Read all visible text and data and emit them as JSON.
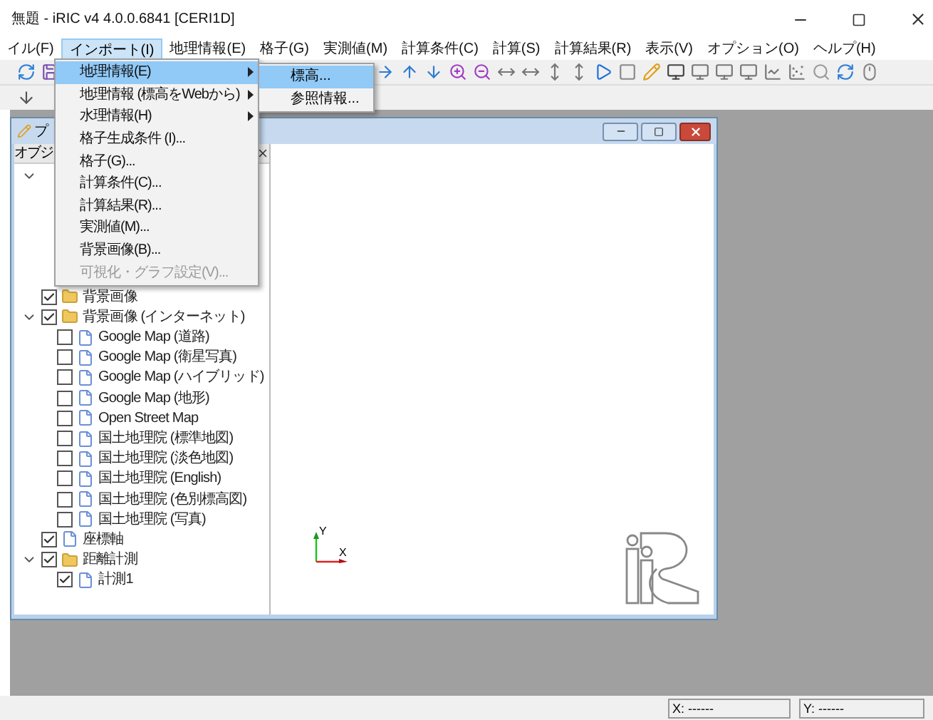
{
  "window": {
    "title": "無題 - iRIC v4 4.0.0.6841 [CERI1D]"
  },
  "menu_bar": [
    {
      "label": "イル(F)",
      "selected": false
    },
    {
      "label": "インポート(I)",
      "selected": true
    },
    {
      "label": "地理情報(E)",
      "selected": false
    },
    {
      "label": "格子(G)",
      "selected": false
    },
    {
      "label": "実測値(M)",
      "selected": false
    },
    {
      "label": "計算条件(C)",
      "selected": false
    },
    {
      "label": "計算(S)",
      "selected": false
    },
    {
      "label": "計算結果(R)",
      "selected": false
    },
    {
      "label": "表示(V)",
      "selected": false
    },
    {
      "label": "オプション(O)",
      "selected": false
    },
    {
      "label": "ヘルプ(H)",
      "selected": false
    }
  ],
  "import_menu": [
    {
      "label": "地理情報(E)",
      "selected": true,
      "submenu": true,
      "disabled": false
    },
    {
      "label": "地理情報 (標高をWebから)",
      "selected": false,
      "submenu": true,
      "disabled": false
    },
    {
      "label": "水理情報(H)",
      "selected": false,
      "submenu": true,
      "disabled": false
    },
    {
      "label": "格子生成条件 (I)...",
      "selected": false,
      "submenu": false,
      "disabled": false
    },
    {
      "label": "格子(G)...",
      "selected": false,
      "submenu": false,
      "disabled": false
    },
    {
      "label": "計算条件(C)...",
      "selected": false,
      "submenu": false,
      "disabled": false
    },
    {
      "label": "計算結果(R)...",
      "selected": false,
      "submenu": false,
      "disabled": false
    },
    {
      "label": "実測値(M)...",
      "selected": false,
      "submenu": false,
      "disabled": false
    },
    {
      "label": "背景画像(B)...",
      "selected": false,
      "submenu": false,
      "disabled": false
    },
    {
      "label": "可視化・グラフ設定(V)...",
      "selected": false,
      "submenu": false,
      "disabled": true
    }
  ],
  "submenu": [
    {
      "label": "標高...",
      "selected": true
    },
    {
      "label": "参照情報...",
      "selected": false
    }
  ],
  "child_window": {
    "title": "プ"
  },
  "object_panel": {
    "title": "オブジ",
    "tree": [
      {
        "kind": "covered",
        "expanded": true
      },
      {
        "kind": "gap"
      },
      {
        "kind": "gap"
      },
      {
        "kind": "gap"
      },
      {
        "kind": "gap"
      },
      {
        "kind": "gap"
      },
      {
        "kind": "folder",
        "label": "背景画像",
        "checked": true
      },
      {
        "kind": "folder",
        "label": "背景画像 (インターネット)",
        "checked": true,
        "expanded": true,
        "children": [
          {
            "kind": "file",
            "label": "Google Map (道路)",
            "checked": false
          },
          {
            "kind": "file",
            "label": "Google Map (衛星写真)",
            "checked": false
          },
          {
            "kind": "file",
            "label": "Google Map (ハイブリッド)",
            "checked": false
          },
          {
            "kind": "file",
            "label": "Google Map (地形)",
            "checked": false
          },
          {
            "kind": "file",
            "label": "Open Street Map",
            "checked": false
          },
          {
            "kind": "file",
            "label": "国土地理院 (標準地図)",
            "checked": false
          },
          {
            "kind": "file",
            "label": "国土地理院 (淡色地図)",
            "checked": false
          },
          {
            "kind": "file",
            "label": "国土地理院 (English)",
            "checked": false
          },
          {
            "kind": "file",
            "label": "国土地理院 (色別標高図)",
            "checked": false
          },
          {
            "kind": "file",
            "label": "国土地理院 (写真)",
            "checked": false
          }
        ]
      },
      {
        "kind": "file",
        "label": "座標軸",
        "checked": true
      },
      {
        "kind": "folder",
        "label": "距離計測",
        "checked": true,
        "expanded": true,
        "children": [
          {
            "kind": "file",
            "label": "計測1",
            "checked": true
          }
        ]
      }
    ]
  },
  "axes": {
    "x": "X",
    "y": "Y"
  },
  "status_bar": {
    "x": "X: ------",
    "y": "Y: ------"
  }
}
